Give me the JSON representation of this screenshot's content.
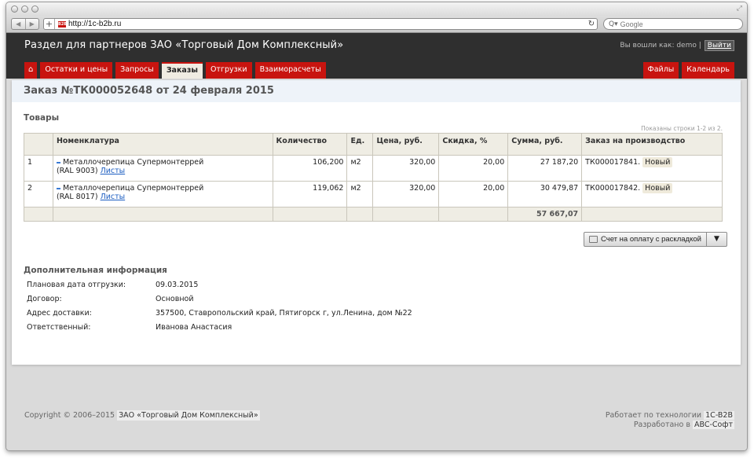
{
  "browser": {
    "url": "http://1c-b2b.ru",
    "search_placeholder": "Google"
  },
  "header": {
    "site_title": "Раздел для партнеров ЗАО «Торговый Дом Комплексный»",
    "logged_in_as": "Вы вошли как: demo |",
    "logout_label": "Выйти"
  },
  "menu": {
    "items": [
      {
        "label": "Остатки и цены"
      },
      {
        "label": "Запросы"
      },
      {
        "label": "Заказы"
      },
      {
        "label": "Отгрузки"
      },
      {
        "label": "Взаиморасчеты"
      }
    ],
    "right_items": [
      {
        "label": "Файлы"
      },
      {
        "label": "Календарь"
      }
    ]
  },
  "page": {
    "title": "Заказ №ТК000052648 от 24 февраля 2015",
    "goods_title": "Товары",
    "rows_info": "Показаны строки 1-2 из 2."
  },
  "table": {
    "headers": [
      "",
      "Номенклатура",
      "Количество",
      "Ед.",
      "Цена, руб.",
      "Скидка, %",
      "Сумма, руб.",
      "Заказ на производство"
    ],
    "rows": [
      {
        "n": "1",
        "name": "Металлочерепица Супермонтеррей",
        "name_extra": "(RAL 9003)",
        "link": "Листы",
        "qty": "106,200",
        "unit": "м2",
        "price": "320,00",
        "discount": "20,00",
        "sum": "27 187,20",
        "order": "ТК000017841.",
        "status": "Новый"
      },
      {
        "n": "2",
        "name": "Металлочерепица Супермонтеррей",
        "name_extra": "(RAL 8017)",
        "link": "Листы",
        "qty": "119,062",
        "unit": "м2",
        "price": "320,00",
        "discount": "20,00",
        "sum": "30 479,87",
        "order": "ТК000017842.",
        "status": "Новый"
      }
    ],
    "total": "57 667,07"
  },
  "actions": {
    "invoice_button": "Счет на оплату с раскладкой",
    "dropdown_symbol": "▼"
  },
  "extra": {
    "title": "Дополнительная информация",
    "rows": [
      {
        "label": "Плановая дата отгрузки:",
        "value": "09.03.2015"
      },
      {
        "label": "Договор:",
        "value": "Основной"
      },
      {
        "label": "Адрес доставки:",
        "value": "357500, Ставропольский край, Пятигорск г, ул.Ленина, дом №22"
      },
      {
        "label": "Ответственный:",
        "value": "Иванова Анастасия"
      }
    ]
  },
  "footer": {
    "copyright": "Copyright © 2006–2015",
    "org": "ЗАО «Торговый Дом Комплексный»",
    "tech_prefix": "Работает по технологии",
    "tech": "1C-B2B",
    "dev_prefix": "Разработано в",
    "dev": "ABC-Софт"
  },
  "colors": {
    "accent": "#c8140f",
    "header_bg": "#2f2f2f",
    "active_tab_bg": "#f0ece2"
  }
}
